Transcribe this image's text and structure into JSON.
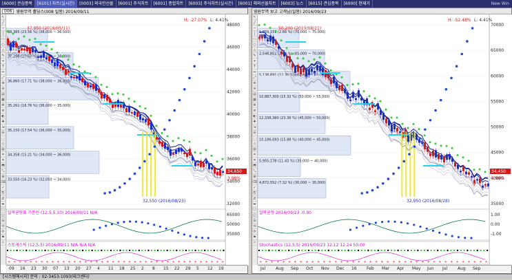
{
  "tabs": [
    "[6000] 관심종목",
    "[6101] 차트(실시간)",
    "[0003] 외국인선물",
    "[6001] 주식차트",
    "[6001] 종합차트",
    "[6003] 주식차트(실시간)",
    "[6001] 해외선물차트",
    "[6003] 뉴스",
    "[6015] 관심종목",
    "[6000] 현재가"
  ],
  "new_win": "New Win",
  "status": "[시스템메시지] 문의 : 02-3453-1093(테크센터)",
  "left": {
    "code": "006",
    "header": "영원무역 홀딩스(008 일봉) 2016/09/11",
    "pct_label": "H: -27.07%",
    "low_pct": "L: 4.41%",
    "price_hi": "37,950 (2016/05/11)",
    "price_lo": "32,550 (2016/08/23)",
    "y_ticks": [
      "48000",
      "46000",
      "44000",
      "42000",
      "40000",
      "38000",
      "36000",
      "34000",
      "32000"
    ],
    "level_labels": [
      "38,385 (23.56 %) (38,000 ~ 36,500)",
      "37,298 (27.57 %) (46,000 ~ 38,000)",
      "36,860 (17.71 %) (38,000 ~ 36,000)",
      "35,261 (16.76 %) (36,000 ~ 35,000)",
      "35,150 (17.54 %) (36,000 ~ 35,000)",
      "34,358 (15.21 %) (34,000 ~ 36,000)",
      "33,550 (16.23 %) (32,050 ~ 34,000)"
    ],
    "ind1": "일목균형표 기준선 (12,5,5,10) 2016/09/11 N/A",
    "ind2": "스토캐스틱 (12,5,5) 2016/09/11 N/A N/A N/A",
    "ind1_ticks": [
      "65000",
      "50000",
      "35000"
    ],
    "x_labels": [
      "09",
      "16",
      "23",
      "30",
      "07",
      "13",
      "20",
      "27",
      "4",
      "11",
      "18",
      "25",
      "2",
      "8",
      "15",
      "22",
      "29",
      "5",
      "12",
      "19"
    ],
    "bottom_date": "09/11",
    "price_right": "34,650",
    "pct_right": "3.98%"
  },
  "right": {
    "header": "영원무역 보고 고객님(일봉) 2016/09/23",
    "pct_label": "H: -52.48%",
    "low_pct": "L: 4.41%",
    "price_hi": "50,200 (2015/08/21)",
    "price_lo": "32,950 (2016/08/28)",
    "y_ticks": [
      "70000",
      "65000",
      "60000",
      "55000",
      "50000",
      "45000",
      "40000",
      "35000"
    ],
    "level_labels": [
      "1,859,151 (2.66 %) (70,000 ~ 75,000)",
      "2,548,851 (3.64 %) (65,000 ~ 70,000)",
      "5,138,891 (12.30 %) (60,000 ~ 65,000)",
      "10,887,300 (15.32 %) (50,000 ~ 55,000)",
      "12,338,380 (23.36 %) (45,000 ~ 50,000)",
      "10,186,093 (15.88 %) (40,000 ~ 45,000)",
      "5,955,178 (11.43 %) (35,000 ~ 40,000)",
      "4,872,552 (7.32 %) (30,000 ~ 35,000)"
    ],
    "ind1": "일목균형 2016/09/23 -0.90",
    "ind2": "Stochastics (12,5,5) 2016/09/23 12.12 12.24 50.00",
    "ind1_ticks": [
      "1.00",
      "0.00",
      "-1.00"
    ],
    "x_labels": [
      "Jul",
      "Aug",
      "Sep",
      "Oct",
      "Nov",
      "Dec",
      "16",
      "Feb",
      "Mar",
      "Apr",
      "May",
      "Jun",
      "Jul",
      "Aug",
      "Sep"
    ],
    "bottom_date": "09/23",
    "price_right": "34,450",
    "pct_right": "1.98%"
  },
  "colors": {
    "up": "#d21a1a",
    "down": "#1a2fc8",
    "cyan": "#22d3ee",
    "green": "#33cc33",
    "magenta": "#d20ad2",
    "orange": "#ff8a00",
    "yellow": "#e8e200",
    "navy": "#13238f"
  }
}
